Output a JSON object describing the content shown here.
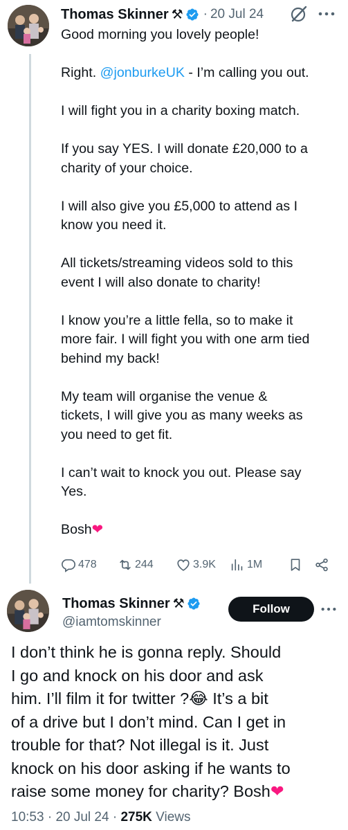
{
  "tweet1": {
    "author_name": "Thomas Skinner",
    "author_badge": "⚒",
    "dot": "·",
    "date": "20 Jul 24",
    "lines": [
      [
        "Good morning you lovely people!"
      ],
      [
        "Right. ",
        "@jonburkeUK",
        " - I’m calling you out."
      ],
      [
        "I will fight you in a charity boxing match."
      ],
      [
        "If you say YES. I will donate £20,000 to a",
        "charity of your choice."
      ],
      [
        "I will also give you £5,000 to attend as I",
        "know you need it."
      ],
      [
        "All tickets/streaming videos sold to this",
        "event I will also donate to charity!"
      ],
      [
        "I know you’re a little fella, so to make it",
        "more fair. I will fight you with one arm tied",
        "behind my back!"
      ],
      [
        "My team will organise the venue &",
        "tickets, I will give you as many weeks as",
        "you need to get fit."
      ],
      [
        "I can’t wait to knock you out. Please say",
        "Yes."
      ],
      [
        "Bosh",
        "❤"
      ]
    ],
    "greeting": "Good morning you lovely people!",
    "right_prefix": "Right. ",
    "mention": "@jonburkeUK",
    "right_suffix": " - I’m calling you out.",
    "p3": "I will fight you in a charity boxing match.",
    "p4a": "If you say YES. I will donate £20,000 to a",
    "p4b": "charity of your choice.",
    "p5a": "I will also give you £5,000 to attend as I",
    "p5b": "know you need it.",
    "p6a": "All tickets/streaming videos sold to this",
    "p6b": "event I will also donate to charity!",
    "p7a": "I know you’re a little fella, so to make it",
    "p7b": "more fair. I will fight you with one arm tied",
    "p7c": "behind my back!",
    "p8a": "My team will organise the venue &",
    "p8b": "tickets, I will give you as many weeks as",
    "p8c": "you need to get fit.",
    "p9a": "I can’t wait to knock you out. Please say",
    "p9b": "Yes.",
    "p10": "Bosh",
    "heart": "❤",
    "actions": {
      "replies": "478",
      "reposts": "244",
      "likes": "3.9K",
      "views": "1M"
    }
  },
  "tweet2": {
    "author_name": "Thomas Skinner",
    "author_badge": "⚒",
    "handle": "@iamtomskinner",
    "follow_label": "Follow",
    "b1": "I don’t think he is gonna reply. Should",
    "b2": "I go and knock on his door and ask",
    "b3": "him. I’ll film it for twitter ?",
    "emoji": "😂",
    "b3b": " It’s a bit",
    "b4": "of a drive but I don’t mind. Can I get in",
    "b5": "trouble for that? Not illegal is it. Just",
    "b6": "knock on his door asking if he wants to",
    "b7": "raise some money for charity? Bosh",
    "heart": "❤",
    "time": "10:53",
    "dot1": " · ",
    "date": "20 Jul 24",
    "dot2": " · ",
    "views_count": "275K",
    "views_label": " Views"
  },
  "colors": {
    "verified": "#1d9bf0",
    "mention": "#1d9bf0",
    "secondary_text": "#536471",
    "heart": "#f91880",
    "follow_bg": "#0f1419"
  },
  "icons": [
    "grok-icon",
    "more-icon",
    "reply-icon",
    "repost-icon",
    "like-icon",
    "views-icon",
    "bookmark-icon",
    "share-icon",
    "verified-badge-icon"
  ]
}
